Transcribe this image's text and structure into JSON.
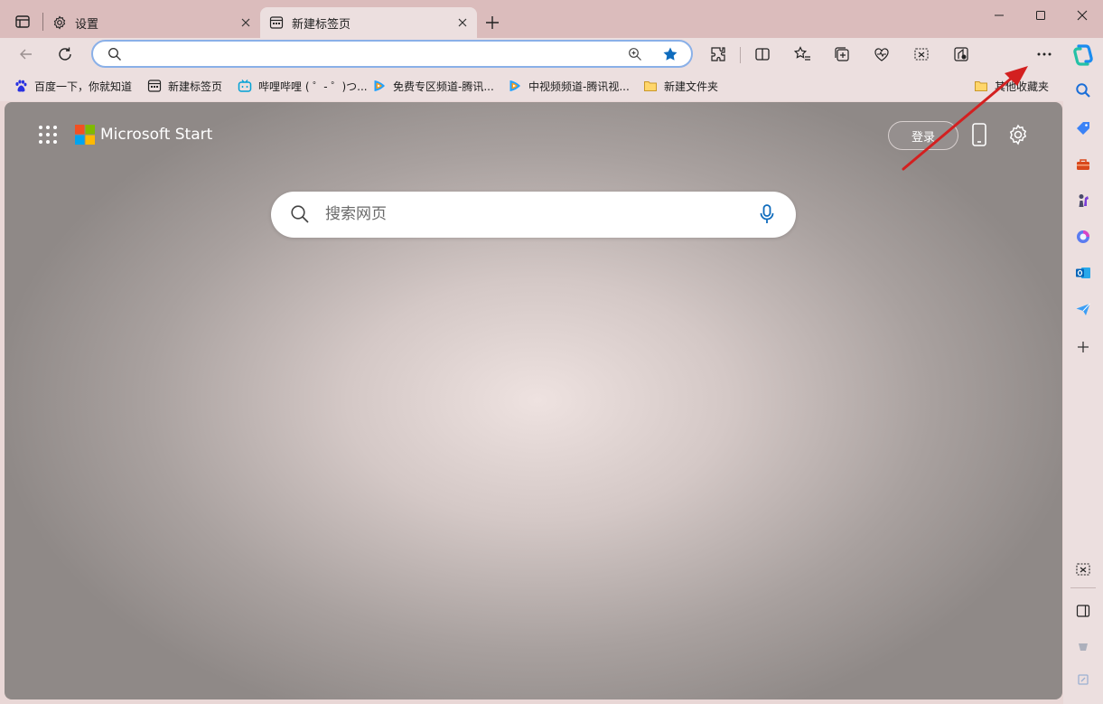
{
  "tabs": [
    {
      "label": "设置",
      "icon": "gear-icon"
    },
    {
      "label": "新建标签页",
      "icon": "new-tab-icon"
    }
  ],
  "address": {
    "value": "",
    "placeholder": ""
  },
  "bookmarks": [
    {
      "label": "百度一下，你就知道",
      "icon": "baidu-paw-icon"
    },
    {
      "label": "新建标签页",
      "icon": "new-tab-icon"
    },
    {
      "label": "哔哩哔哩 ( ゜- ゜)つ...",
      "icon": "bilibili-icon"
    },
    {
      "label": "免费专区频道-腾讯...",
      "icon": "tencent-video-icon"
    },
    {
      "label": "中视频频道-腾讯视...",
      "icon": "tencent-video-icon"
    },
    {
      "label": "新建文件夹",
      "icon": "folder-icon"
    },
    {
      "label": "其他收藏夹",
      "icon": "folder-icon"
    }
  ],
  "start": {
    "brand": "Microsoft Start",
    "login_label": "登录",
    "search_placeholder": "搜索网页"
  },
  "colors": {
    "accent": "#0f6cbd",
    "annotation_arrow": "#d32020"
  }
}
